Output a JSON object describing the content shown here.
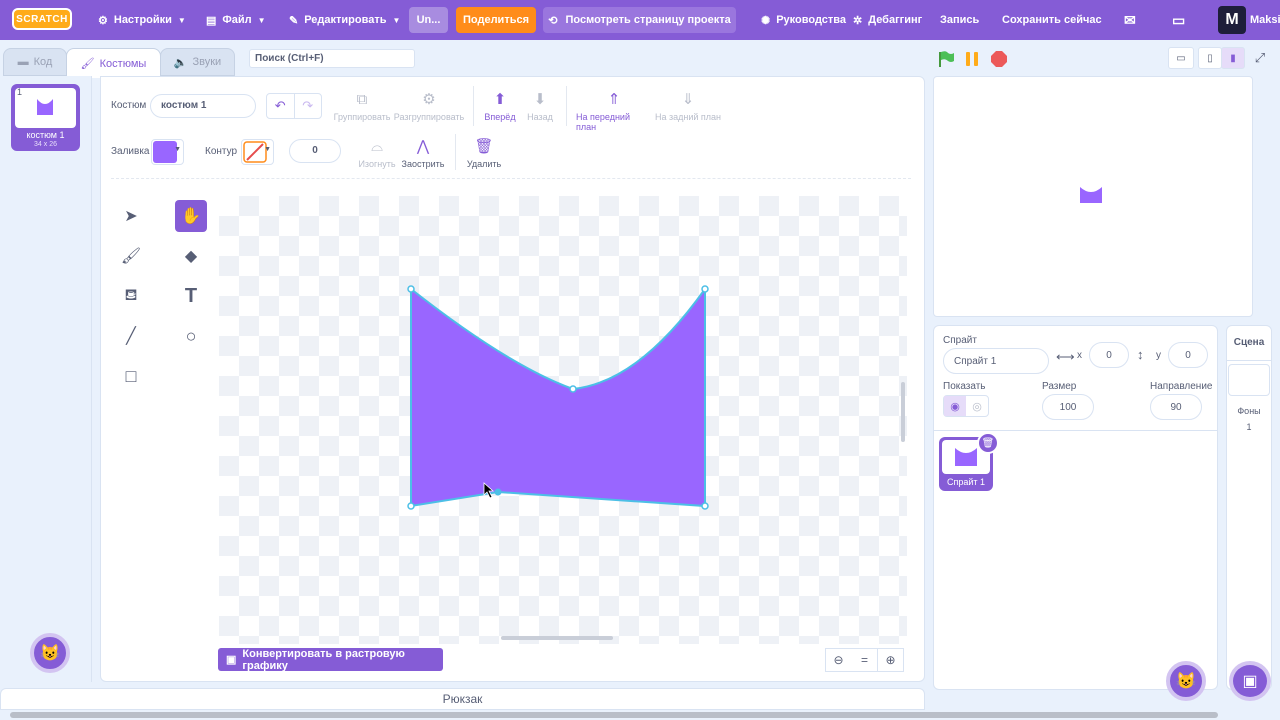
{
  "menubar": {
    "logo": "SCRATCH",
    "settings": "Настройки",
    "file": "Файл",
    "edit": "Редактировать",
    "project_title": "Un...",
    "share": "Поделиться",
    "see_project_page": "Посмотреть страницу проекта",
    "tutorials": "Руководства",
    "debugging": "Дебаггинг",
    "record": "Запись",
    "save_now": "Сохранить сейчас",
    "username": "Maksi",
    "avatar_letter": "M"
  },
  "tabs": {
    "code": "Код",
    "costumes": "Костюмы",
    "sounds": "Звуки"
  },
  "search": {
    "placeholder": "Поиск (Ctrl+F)"
  },
  "costume_list": {
    "items": [
      {
        "number": "1",
        "name": "костюм 1",
        "size": "34 x 26"
      }
    ]
  },
  "editor": {
    "costume_label": "Костюм",
    "costume_name": "костюм 1",
    "group": "Группировать",
    "ungroup": "Разгруппировать",
    "forward": "Вперёд",
    "backward": "Назад",
    "front": "На передний план",
    "back": "На задний план",
    "fill_label": "Заливка",
    "outline_label": "Контур",
    "outline_width": "0",
    "curved": "Изогнуть",
    "pointed": "Заострить",
    "delete": "Удалить",
    "convert": "Конвертировать в растровую графику",
    "fill_color": "#9966ff",
    "outline_color": "#4cbfe6"
  },
  "sprite_info": {
    "sprite_label": "Спрайт",
    "sprite_name": "Спрайт 1",
    "x_label": "x",
    "x_value": "0",
    "y_label": "y",
    "y_value": "0",
    "show_label": "Показать",
    "size_label": "Размер",
    "size_value": "100",
    "direction_label": "Направление",
    "direction_value": "90"
  },
  "sprites": [
    {
      "name": "Спрайт 1"
    }
  ],
  "stage_panel": {
    "title": "Сцена",
    "backdrops_label": "Фоны",
    "backdrops_count": "1"
  },
  "backpack": "Рюкзак"
}
